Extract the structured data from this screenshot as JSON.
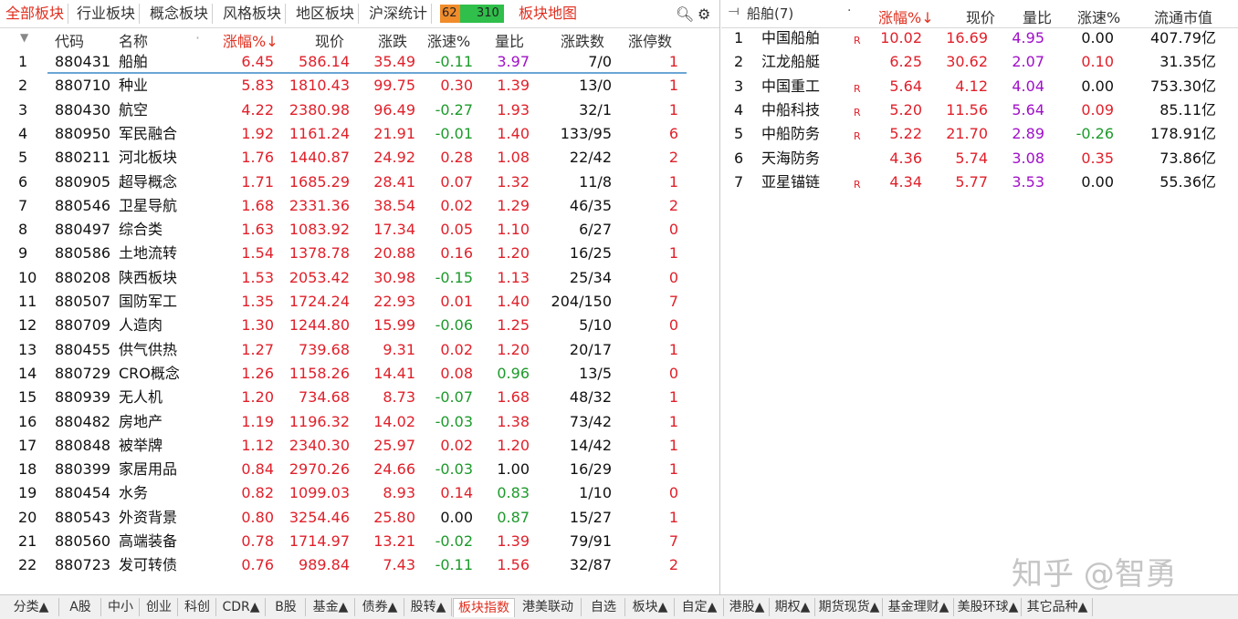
{
  "top_tabs": [
    "全部板块",
    "行业板块",
    "概念板块",
    "风格板块",
    "地区板块",
    "沪深统计"
  ],
  "up_count": "62",
  "down_count": "310",
  "map_tab": "板块地图",
  "left_headers": {
    "code": "代码",
    "name": "名称",
    "change_pct": "涨幅%",
    "price": "现价",
    "change": "涨跌",
    "speed": "涨速%",
    "volume_ratio": "量比",
    "up_down_count": "涨跌数",
    "limit_up_count": "涨停数"
  },
  "sectors": [
    {
      "idx": "1",
      "code": "880431",
      "name": "船舶",
      "pct": "6.45",
      "price": "586.14",
      "chg": "35.49",
      "speed": "-0.11",
      "vr": "3.97",
      "updown": "7/0",
      "limit": "1"
    },
    {
      "idx": "2",
      "code": "880710",
      "name": "种业",
      "pct": "5.83",
      "price": "1810.43",
      "chg": "99.75",
      "speed": "0.30",
      "vr": "1.39",
      "updown": "13/0",
      "limit": "1"
    },
    {
      "idx": "3",
      "code": "880430",
      "name": "航空",
      "pct": "4.22",
      "price": "2380.98",
      "chg": "96.49",
      "speed": "-0.27",
      "vr": "1.93",
      "updown": "32/1",
      "limit": "1"
    },
    {
      "idx": "4",
      "code": "880950",
      "name": "军民融合",
      "pct": "1.92",
      "price": "1161.24",
      "chg": "21.91",
      "speed": "-0.01",
      "vr": "1.40",
      "updown": "133/95",
      "limit": "6"
    },
    {
      "idx": "5",
      "code": "880211",
      "name": "河北板块",
      "pct": "1.76",
      "price": "1440.87",
      "chg": "24.92",
      "speed": "0.28",
      "vr": "1.08",
      "updown": "22/42",
      "limit": "2"
    },
    {
      "idx": "6",
      "code": "880905",
      "name": "超导概念",
      "pct": "1.71",
      "price": "1685.29",
      "chg": "28.41",
      "speed": "0.07",
      "vr": "1.32",
      "updown": "11/8",
      "limit": "1"
    },
    {
      "idx": "7",
      "code": "880546",
      "name": "卫星导航",
      "pct": "1.68",
      "price": "2331.36",
      "chg": "38.54",
      "speed": "0.02",
      "vr": "1.29",
      "updown": "46/35",
      "limit": "2"
    },
    {
      "idx": "8",
      "code": "880497",
      "name": "综合类",
      "pct": "1.63",
      "price": "1083.92",
      "chg": "17.34",
      "speed": "0.05",
      "vr": "1.10",
      "updown": "6/27",
      "limit": "0"
    },
    {
      "idx": "9",
      "code": "880586",
      "name": "土地流转",
      "pct": "1.54",
      "price": "1378.78",
      "chg": "20.88",
      "speed": "0.16",
      "vr": "1.20",
      "updown": "16/25",
      "limit": "1"
    },
    {
      "idx": "10",
      "code": "880208",
      "name": "陕西板块",
      "pct": "1.53",
      "price": "2053.42",
      "chg": "30.98",
      "speed": "-0.15",
      "vr": "1.13",
      "updown": "25/34",
      "limit": "0"
    },
    {
      "idx": "11",
      "code": "880507",
      "name": "国防军工",
      "pct": "1.35",
      "price": "1724.24",
      "chg": "22.93",
      "speed": "0.01",
      "vr": "1.40",
      "updown": "204/150",
      "limit": "7"
    },
    {
      "idx": "12",
      "code": "880709",
      "name": "人造肉",
      "pct": "1.30",
      "price": "1244.80",
      "chg": "15.99",
      "speed": "-0.06",
      "vr": "1.25",
      "updown": "5/10",
      "limit": "0"
    },
    {
      "idx": "13",
      "code": "880455",
      "name": "供气供热",
      "pct": "1.27",
      "price": "739.68",
      "chg": "9.31",
      "speed": "0.02",
      "vr": "1.20",
      "updown": "20/17",
      "limit": "1"
    },
    {
      "idx": "14",
      "code": "880729",
      "name": "CRO概念",
      "pct": "1.26",
      "price": "1158.26",
      "chg": "14.41",
      "speed": "0.08",
      "vr": "0.96",
      "updown": "13/5",
      "limit": "0"
    },
    {
      "idx": "15",
      "code": "880939",
      "name": "无人机",
      "pct": "1.20",
      "price": "734.68",
      "chg": "8.73",
      "speed": "-0.07",
      "vr": "1.68",
      "updown": "48/32",
      "limit": "1"
    },
    {
      "idx": "16",
      "code": "880482",
      "name": "房地产",
      "pct": "1.19",
      "price": "1196.32",
      "chg": "14.02",
      "speed": "-0.03",
      "vr": "1.38",
      "updown": "73/42",
      "limit": "1"
    },
    {
      "idx": "17",
      "code": "880848",
      "name": "被举牌",
      "pct": "1.12",
      "price": "2340.30",
      "chg": "25.97",
      "speed": "0.02",
      "vr": "1.20",
      "updown": "14/42",
      "limit": "1"
    },
    {
      "idx": "18",
      "code": "880399",
      "name": "家居用品",
      "pct": "0.84",
      "price": "2970.26",
      "chg": "24.66",
      "speed": "-0.03",
      "vr": "1.00",
      "updown": "16/29",
      "limit": "1"
    },
    {
      "idx": "19",
      "code": "880454",
      "name": "水务",
      "pct": "0.82",
      "price": "1099.03",
      "chg": "8.93",
      "speed": "0.14",
      "vr": "0.83",
      "updown": "1/10",
      "limit": "0"
    },
    {
      "idx": "20",
      "code": "880543",
      "name": "外资背景",
      "pct": "0.80",
      "price": "3254.46",
      "chg": "25.80",
      "speed": "0.00",
      "vr": "0.87",
      "updown": "15/27",
      "limit": "1"
    },
    {
      "idx": "21",
      "code": "880560",
      "name": "高端装备",
      "pct": "0.78",
      "price": "1714.97",
      "chg": "13.21",
      "speed": "-0.02",
      "vr": "1.39",
      "updown": "79/91",
      "limit": "7"
    },
    {
      "idx": "22",
      "code": "880723",
      "name": "发可转债",
      "pct": "0.76",
      "price": "989.84",
      "chg": "7.43",
      "speed": "-0.11",
      "vr": "1.56",
      "updown": "32/87",
      "limit": "2"
    }
  ],
  "right_panel": {
    "title": "船舶(7)",
    "headers": {
      "change_pct": "涨幅%",
      "price": "现价",
      "volume_ratio": "量比",
      "speed": "涨速%",
      "float_cap": "流通市值"
    },
    "stocks": [
      {
        "idx": "1",
        "name": "中国船舶",
        "tag": "R",
        "pct": "10.02",
        "price": "16.69",
        "vr": "4.95",
        "speed": "0.00",
        "cap": "407.79亿"
      },
      {
        "idx": "2",
        "name": "江龙船艇",
        "tag": "",
        "pct": "6.25",
        "price": "30.62",
        "vr": "2.07",
        "speed": "0.10",
        "cap": "31.35亿"
      },
      {
        "idx": "3",
        "name": "中国重工",
        "tag": "R",
        "pct": "5.64",
        "price": "4.12",
        "vr": "4.04",
        "speed": "0.00",
        "cap": "753.30亿"
      },
      {
        "idx": "4",
        "name": "中船科技",
        "tag": "R",
        "pct": "5.20",
        "price": "11.56",
        "vr": "5.64",
        "speed": "0.09",
        "cap": "85.11亿"
      },
      {
        "idx": "5",
        "name": "中船防务",
        "tag": "R",
        "pct": "5.22",
        "price": "21.70",
        "vr": "2.89",
        "speed": "-0.26",
        "cap": "178.91亿"
      },
      {
        "idx": "6",
        "name": "天海防务",
        "tag": "",
        "pct": "4.36",
        "price": "5.74",
        "vr": "3.08",
        "speed": "0.35",
        "cap": "73.86亿"
      },
      {
        "idx": "7",
        "name": "亚星锚链",
        "tag": "R",
        "pct": "4.34",
        "price": "5.77",
        "vr": "3.53",
        "speed": "0.00",
        "cap": "55.36亿"
      }
    ]
  },
  "bottom_tabs": [
    "分类▲",
    "A股",
    "中小",
    "创业",
    "科创",
    "CDR▲",
    "B股",
    "基金▲",
    "债券▲",
    "股转▲",
    "板块指数",
    "港美联动",
    "自选",
    "板块▲",
    "自定▲",
    "港股▲",
    "期权▲",
    "期货现货▲",
    "基金理财▲",
    "美股环球▲",
    "其它品种▲"
  ],
  "watermark": "知乎 @智勇"
}
